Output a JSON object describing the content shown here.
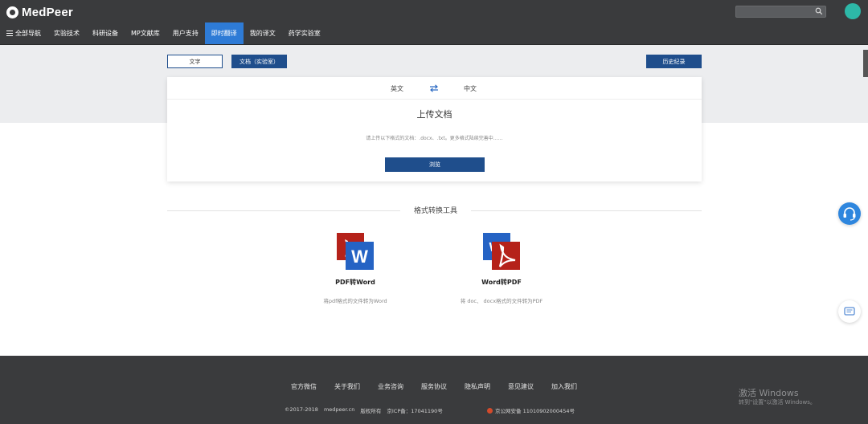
{
  "header": {
    "logo": "MedPeer",
    "search": {
      "placeholder": ""
    },
    "nav": [
      {
        "label": "全部导航",
        "icon": "menu-icon"
      },
      {
        "label": "实验技术"
      },
      {
        "label": "科研设备"
      },
      {
        "label": "MP文献库"
      },
      {
        "label": "用户支持"
      },
      {
        "label": "即时翻译",
        "active": true
      },
      {
        "label": "我的译文"
      },
      {
        "label": "药学实验室"
      }
    ]
  },
  "toolbar": {
    "text_tab": "文字",
    "doc_tab": "文档（实验室）",
    "history": "历史纪录"
  },
  "translator": {
    "source_lang": "英文",
    "target_lang": "中文",
    "upload_title": "上传文档",
    "upload_hint": "请上传以下格式的文档：.docx、.txt。更多格式陆续完善中……",
    "browse_label": "浏览"
  },
  "tools": {
    "section_title": "格式转换工具",
    "items": [
      {
        "name": "PDF转Word",
        "desc": "将pdf格式的文件转为Word"
      },
      {
        "name": "Word转PDF",
        "desc": "将 doc、 docx格式的文件转为PDF"
      }
    ]
  },
  "footer": {
    "links": [
      "官方微信",
      "关于我们",
      "业务咨询",
      "服务协议",
      "隐私声明",
      "意见建议",
      "加入我们"
    ],
    "copyright_year": "©2017-2018",
    "domain": "medpeer.cn",
    "rights": "版权所有",
    "icp": "京ICP备：17041190号",
    "police": "京公网安备 11010902000454号"
  },
  "watermark": {
    "title": "激活 Windows",
    "subtitle": "转到\"设置\"以激活 Windows。"
  },
  "colors": {
    "topbar": "#3a3b3d",
    "accent": "#1f4e8c",
    "active_nav": "#2e7bd6",
    "avatar": "#2db8a8",
    "pdf_red": "#b5221a",
    "word_blue": "#2563c4"
  }
}
